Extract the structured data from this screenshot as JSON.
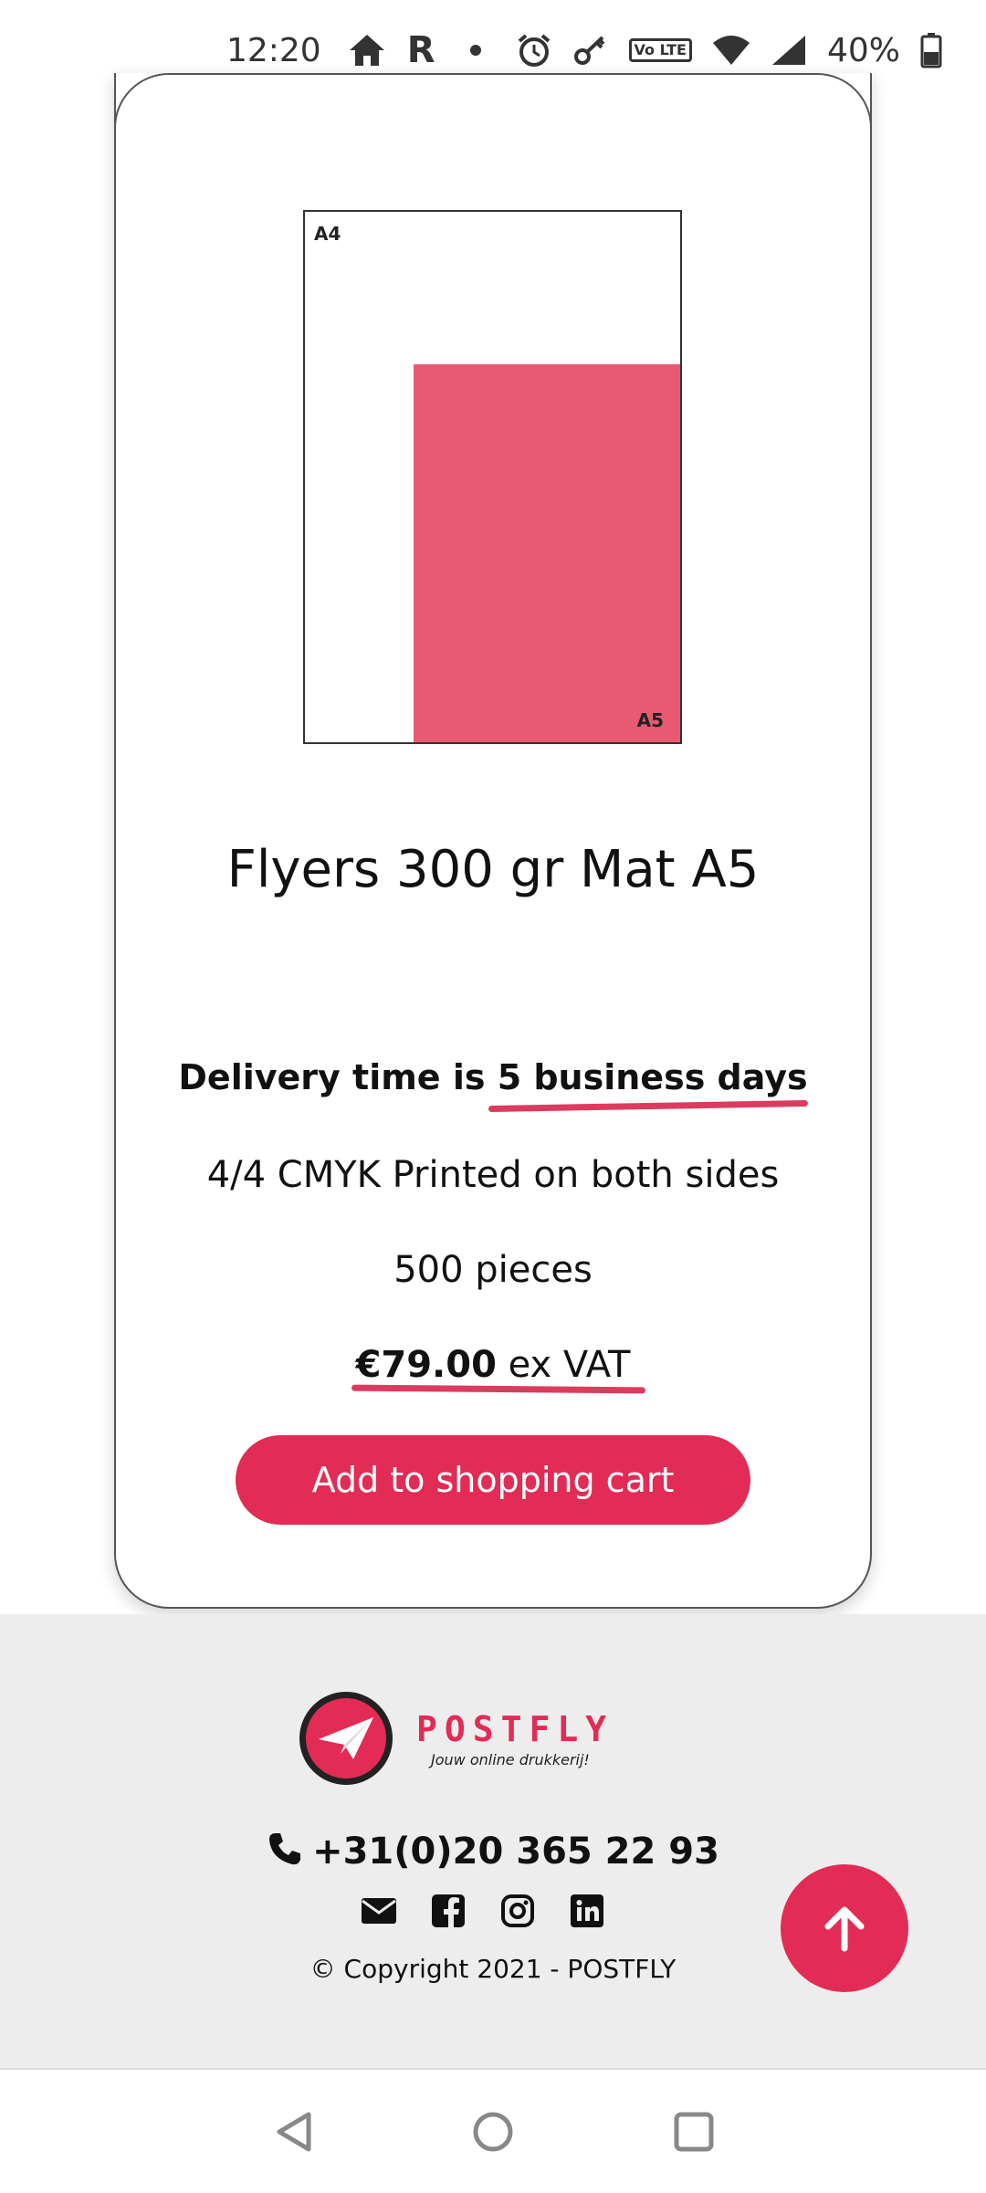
{
  "status_bar": {
    "time": "12:20",
    "carrier_letter": "R",
    "volte": "Vo LTE",
    "battery": "40%",
    "icons": [
      "home-icon",
      "dot-icon",
      "alarm-icon",
      "key-icon",
      "volte-icon",
      "wifi-icon",
      "signal-icon",
      "battery-icon"
    ]
  },
  "product": {
    "diagram": {
      "outer_label": "A4",
      "inner_label": "A5",
      "accent_color": "#e85a72"
    },
    "title": "Flyers 300 gr Mat A5",
    "delivery_prefix": "Delivery time is ",
    "delivery_highlight": "5 business days",
    "print_info": "4/4 CMYK Printed on both sides",
    "quantity": "500 pieces",
    "price_amount": "€79.00",
    "price_suffix": " ex VAT",
    "add_button": "Add to shopping cart"
  },
  "footer": {
    "brand": "POSTFLY",
    "tagline": "Jouw online drukkerij!",
    "phone": "+31(0)20 365 22 93",
    "social_icons": [
      "email-icon",
      "facebook-icon",
      "instagram-icon",
      "linkedin-icon"
    ],
    "copyright": "© Copyright 2021 - POSTFLY"
  },
  "fab": {
    "icon": "arrow-up-icon"
  },
  "nav": {
    "icons": [
      "back-icon",
      "home-circle-icon",
      "recents-icon"
    ]
  },
  "colors": {
    "brand": "#e22b55",
    "underline": "#d8264d",
    "footer_bg": "#ededed"
  }
}
